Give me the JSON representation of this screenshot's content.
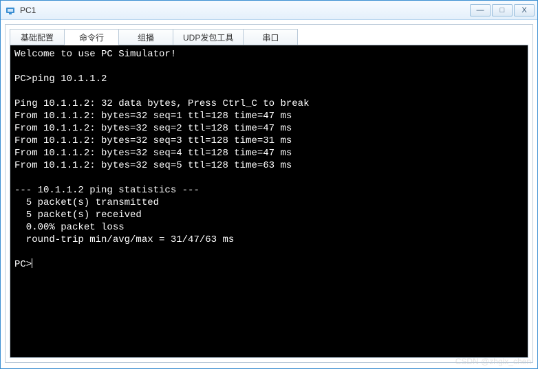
{
  "window": {
    "title": "PC1"
  },
  "tabs": [
    {
      "label": "基础配置"
    },
    {
      "label": "命令行"
    },
    {
      "label": "组播"
    },
    {
      "label": "UDP发包工具"
    },
    {
      "label": "串口"
    }
  ],
  "active_tab_index": 1,
  "terminal": {
    "lines": [
      "Welcome to use PC Simulator!",
      "",
      "PC>ping 10.1.1.2",
      "",
      "Ping 10.1.1.2: 32 data bytes, Press Ctrl_C to break",
      "From 10.1.1.2: bytes=32 seq=1 ttl=128 time=47 ms",
      "From 10.1.1.2: bytes=32 seq=2 ttl=128 time=47 ms",
      "From 10.1.1.2: bytes=32 seq=3 ttl=128 time=31 ms",
      "From 10.1.1.2: bytes=32 seq=4 ttl=128 time=47 ms",
      "From 10.1.1.2: bytes=32 seq=5 ttl=128 time=63 ms",
      "",
      "--- 10.1.1.2 ping statistics ---",
      "  5 packet(s) transmitted",
      "  5 packet(s) received",
      "  0.00% packet loss",
      "  round-trip min/avg/max = 31/47/63 ms",
      "",
      "PC>"
    ],
    "prompt": "PC>",
    "command": "ping 10.1.1.2",
    "ping": {
      "target": "10.1.1.2",
      "bytes": 32,
      "replies": [
        {
          "from": "10.1.1.2",
          "bytes": 32,
          "seq": 1,
          "ttl": 128,
          "time_ms": 47
        },
        {
          "from": "10.1.1.2",
          "bytes": 32,
          "seq": 2,
          "ttl": 128,
          "time_ms": 47
        },
        {
          "from": "10.1.1.2",
          "bytes": 32,
          "seq": 3,
          "ttl": 128,
          "time_ms": 31
        },
        {
          "from": "10.1.1.2",
          "bytes": 32,
          "seq": 4,
          "ttl": 128,
          "time_ms": 47
        },
        {
          "from": "10.1.1.2",
          "bytes": 32,
          "seq": 5,
          "ttl": 128,
          "time_ms": 63
        }
      ],
      "statistics": {
        "transmitted": 5,
        "received": 5,
        "loss_percent": 0.0,
        "min_ms": 31,
        "avg_ms": 47,
        "max_ms": 63
      }
    }
  },
  "watermark": "CSDN @zhgix_chen"
}
